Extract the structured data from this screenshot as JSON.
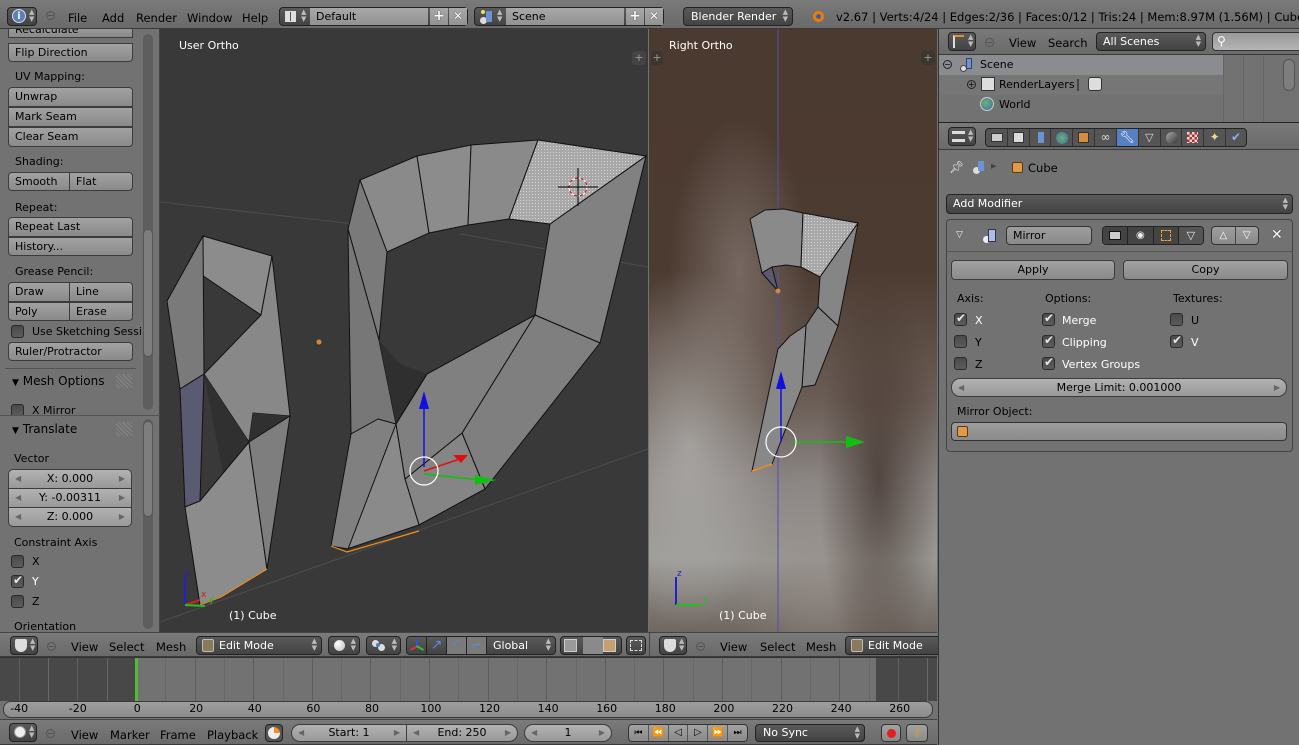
{
  "top_header": {
    "menus": [
      "File",
      "Add",
      "Render",
      "Window",
      "Help"
    ],
    "screen_layout": "Default",
    "scene": "Scene",
    "render_engine": "Blender Render",
    "stats": "v2.67 | Verts:4/24 | Edges:2/36 | Faces:0/12 | Tris:24 | Mem:8.97M (1.56M) | Cube"
  },
  "tool_shelf": {
    "partial_top_button": "Recalculate",
    "flip_direction": "Flip Direction",
    "uv_mapping_label": "UV Mapping:",
    "unwrap": "Unwrap",
    "mark_seam": "Mark Seam",
    "clear_seam": "Clear Seam",
    "shading_label": "Shading:",
    "smooth": "Smooth",
    "flat": "Flat",
    "repeat_label": "Repeat:",
    "repeat_last": "Repeat Last",
    "history": "History...",
    "grease_pencil_label": "Grease Pencil:",
    "draw": "Draw",
    "line": "Line",
    "poly": "Poly",
    "erase": "Erase",
    "use_sketching": "Use Sketching Sessi",
    "ruler": "Ruler/Protractor",
    "mesh_options_title": "Mesh Options",
    "x_mirror": "X Mirror"
  },
  "operator_panel": {
    "title": "Translate",
    "vector_label": "Vector",
    "x": "X: 0.000",
    "y": "Y: -0.00311",
    "z": "Z: 0.000",
    "constraint_label": "Constraint Axis",
    "axes": [
      {
        "label": "X",
        "checked": false
      },
      {
        "label": "Y",
        "checked": true
      },
      {
        "label": "Z",
        "checked": false
      }
    ],
    "orientation_label": "Orientation"
  },
  "viewport_left": {
    "view_name": "User Ortho",
    "object_label": "(1) Cube",
    "axis_labels": {
      "z": "z",
      "x": "x",
      "y": "y"
    }
  },
  "viewport_right": {
    "view_name": "Right Ortho",
    "object_label": "(1) Cube",
    "axis_labels": {
      "z": "z",
      "y": "y"
    }
  },
  "view3d_header_left": {
    "menus": [
      "View",
      "Select",
      "Mesh"
    ],
    "mode": "Edit Mode",
    "orientation": "Global"
  },
  "view3d_header_right": {
    "menus": [
      "View",
      "Select",
      "Mesh"
    ],
    "mode": "Edit Mode"
  },
  "timeline": {
    "ticks": [
      "-40",
      "-20",
      "0",
      "20",
      "40",
      "60",
      "80",
      "100",
      "120",
      "140",
      "160",
      "180",
      "200",
      "220",
      "240",
      "260"
    ],
    "current_frame_value": 1,
    "menus": [
      "View",
      "Marker",
      "Frame",
      "Playback"
    ],
    "start": "Start: 1",
    "end": "End: 250",
    "current_frame": "1",
    "sync": "No Sync"
  },
  "outliner": {
    "menus": [
      "View",
      "Search"
    ],
    "filter": "All Scenes",
    "search_placeholder": "",
    "items": [
      {
        "label": "Scene",
        "level": 0,
        "selected": true
      },
      {
        "label": "RenderLayers",
        "level": 1,
        "selected": false
      },
      {
        "label": "World",
        "level": 1,
        "selected": false
      }
    ]
  },
  "properties": {
    "tabs": [
      "render",
      "render-layers",
      "scene",
      "world",
      "object",
      "constraints",
      "modifiers",
      "data",
      "material",
      "texture",
      "particles",
      "physics"
    ],
    "active_tab": "modifiers",
    "breadcrumb_object": "Cube",
    "add_modifier": "Add Modifier",
    "modifier": {
      "name": "Mirror",
      "apply": "Apply",
      "copy": "Copy",
      "axis_label": "Axis:",
      "options_label": "Options:",
      "textures_label": "Textures:",
      "axis": [
        {
          "label": "X",
          "checked": true
        },
        {
          "label": "Y",
          "checked": false
        },
        {
          "label": "Z",
          "checked": false
        }
      ],
      "options": [
        {
          "label": "Merge",
          "checked": true
        },
        {
          "label": "Clipping",
          "checked": true
        },
        {
          "label": "Vertex Groups",
          "checked": true
        }
      ],
      "textures": [
        {
          "label": "U",
          "checked": false
        },
        {
          "label": "V",
          "checked": true
        }
      ],
      "merge_limit": "Merge Limit: 0.001000",
      "mirror_object_label": "Mirror Object:",
      "mirror_object_value": ""
    }
  },
  "colors": {
    "viewport_bg": "#393939",
    "selection_orange": "#f0901a",
    "active_tab_blue": "#5680c2",
    "playhead_green": "#4dbd33"
  }
}
